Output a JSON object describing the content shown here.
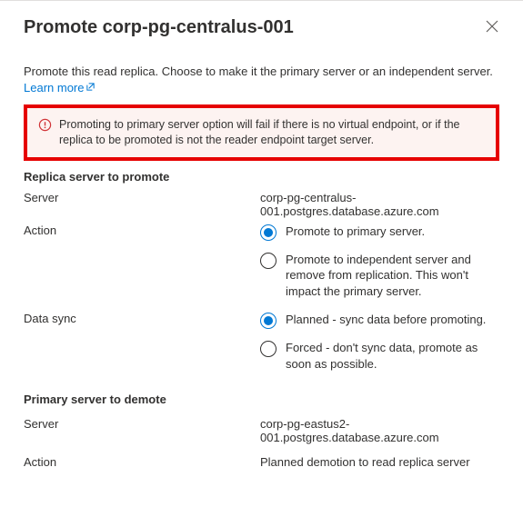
{
  "header": {
    "title": "Promote corp-pg-centralus-001"
  },
  "intro": {
    "text": "Promote this read replica. Choose to make it the primary server or an independent server.",
    "learn_more": "Learn more"
  },
  "callout": {
    "text": "Promoting to primary server option will fail if there is no virtual endpoint, or if the replica to be promoted is not the reader endpoint target server."
  },
  "replica": {
    "section_title": "Replica server to promote",
    "server_label": "Server",
    "server_value": "corp-pg-centralus-001.postgres.database.azure.com",
    "action_label": "Action",
    "action_options": [
      {
        "label": "Promote to primary server.",
        "selected": true
      },
      {
        "label": "Promote to independent server and remove from replication. This won't impact the primary server.",
        "selected": false
      }
    ],
    "datasync_label": "Data sync",
    "datasync_options": [
      {
        "label": "Planned - sync data before promoting.",
        "selected": true
      },
      {
        "label": "Forced - don't sync data, promote as soon as possible.",
        "selected": false
      }
    ]
  },
  "primary": {
    "section_title": "Primary server to demote",
    "server_label": "Server",
    "server_value": "corp-pg-eastus2-001.postgres.database.azure.com",
    "action_label": "Action",
    "action_value": "Planned demotion to read replica server"
  }
}
